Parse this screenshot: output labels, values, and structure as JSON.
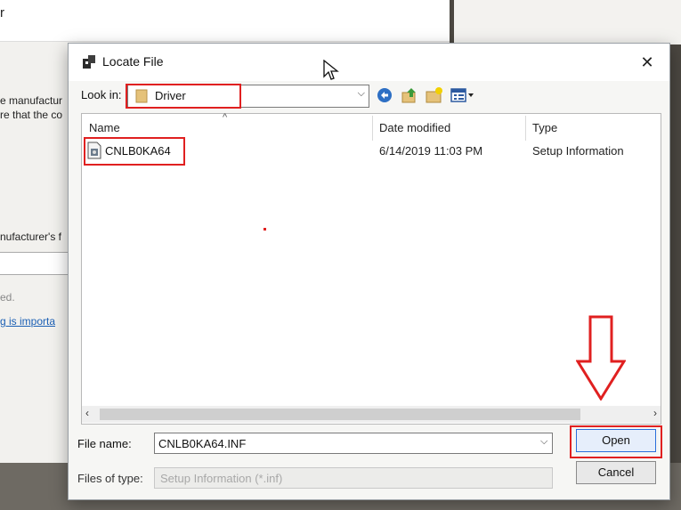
{
  "background": {
    "title_fragment": "r",
    "text_lines": [
      "e manufactur",
      "re that the co",
      "nufacturer's f",
      "ed.",
      "g is importa"
    ]
  },
  "dialog": {
    "title": "Locate File",
    "close_glyph": "✕",
    "look_in": {
      "label": "Look in:",
      "value": "Driver"
    },
    "toolbar": [
      "back-icon",
      "up-folder-icon",
      "new-folder-icon",
      "view-menu-icon"
    ],
    "columns": {
      "name": "Name",
      "date_modified": "Date modified",
      "type": "Type"
    },
    "files": [
      {
        "name": "CNLB0KA64",
        "date_modified": "6/14/2019 11:03 PM",
        "type": "Setup Information"
      }
    ],
    "file_name": {
      "label": "File name:",
      "value": "CNLB0KA64.INF"
    },
    "files_of_type": {
      "label": "Files of type:",
      "value": "Setup Information (*.inf)"
    },
    "buttons": {
      "open": "Open",
      "cancel": "Cancel"
    }
  },
  "colors": {
    "highlight": "#e02020",
    "accent": "#2a6fdb"
  }
}
